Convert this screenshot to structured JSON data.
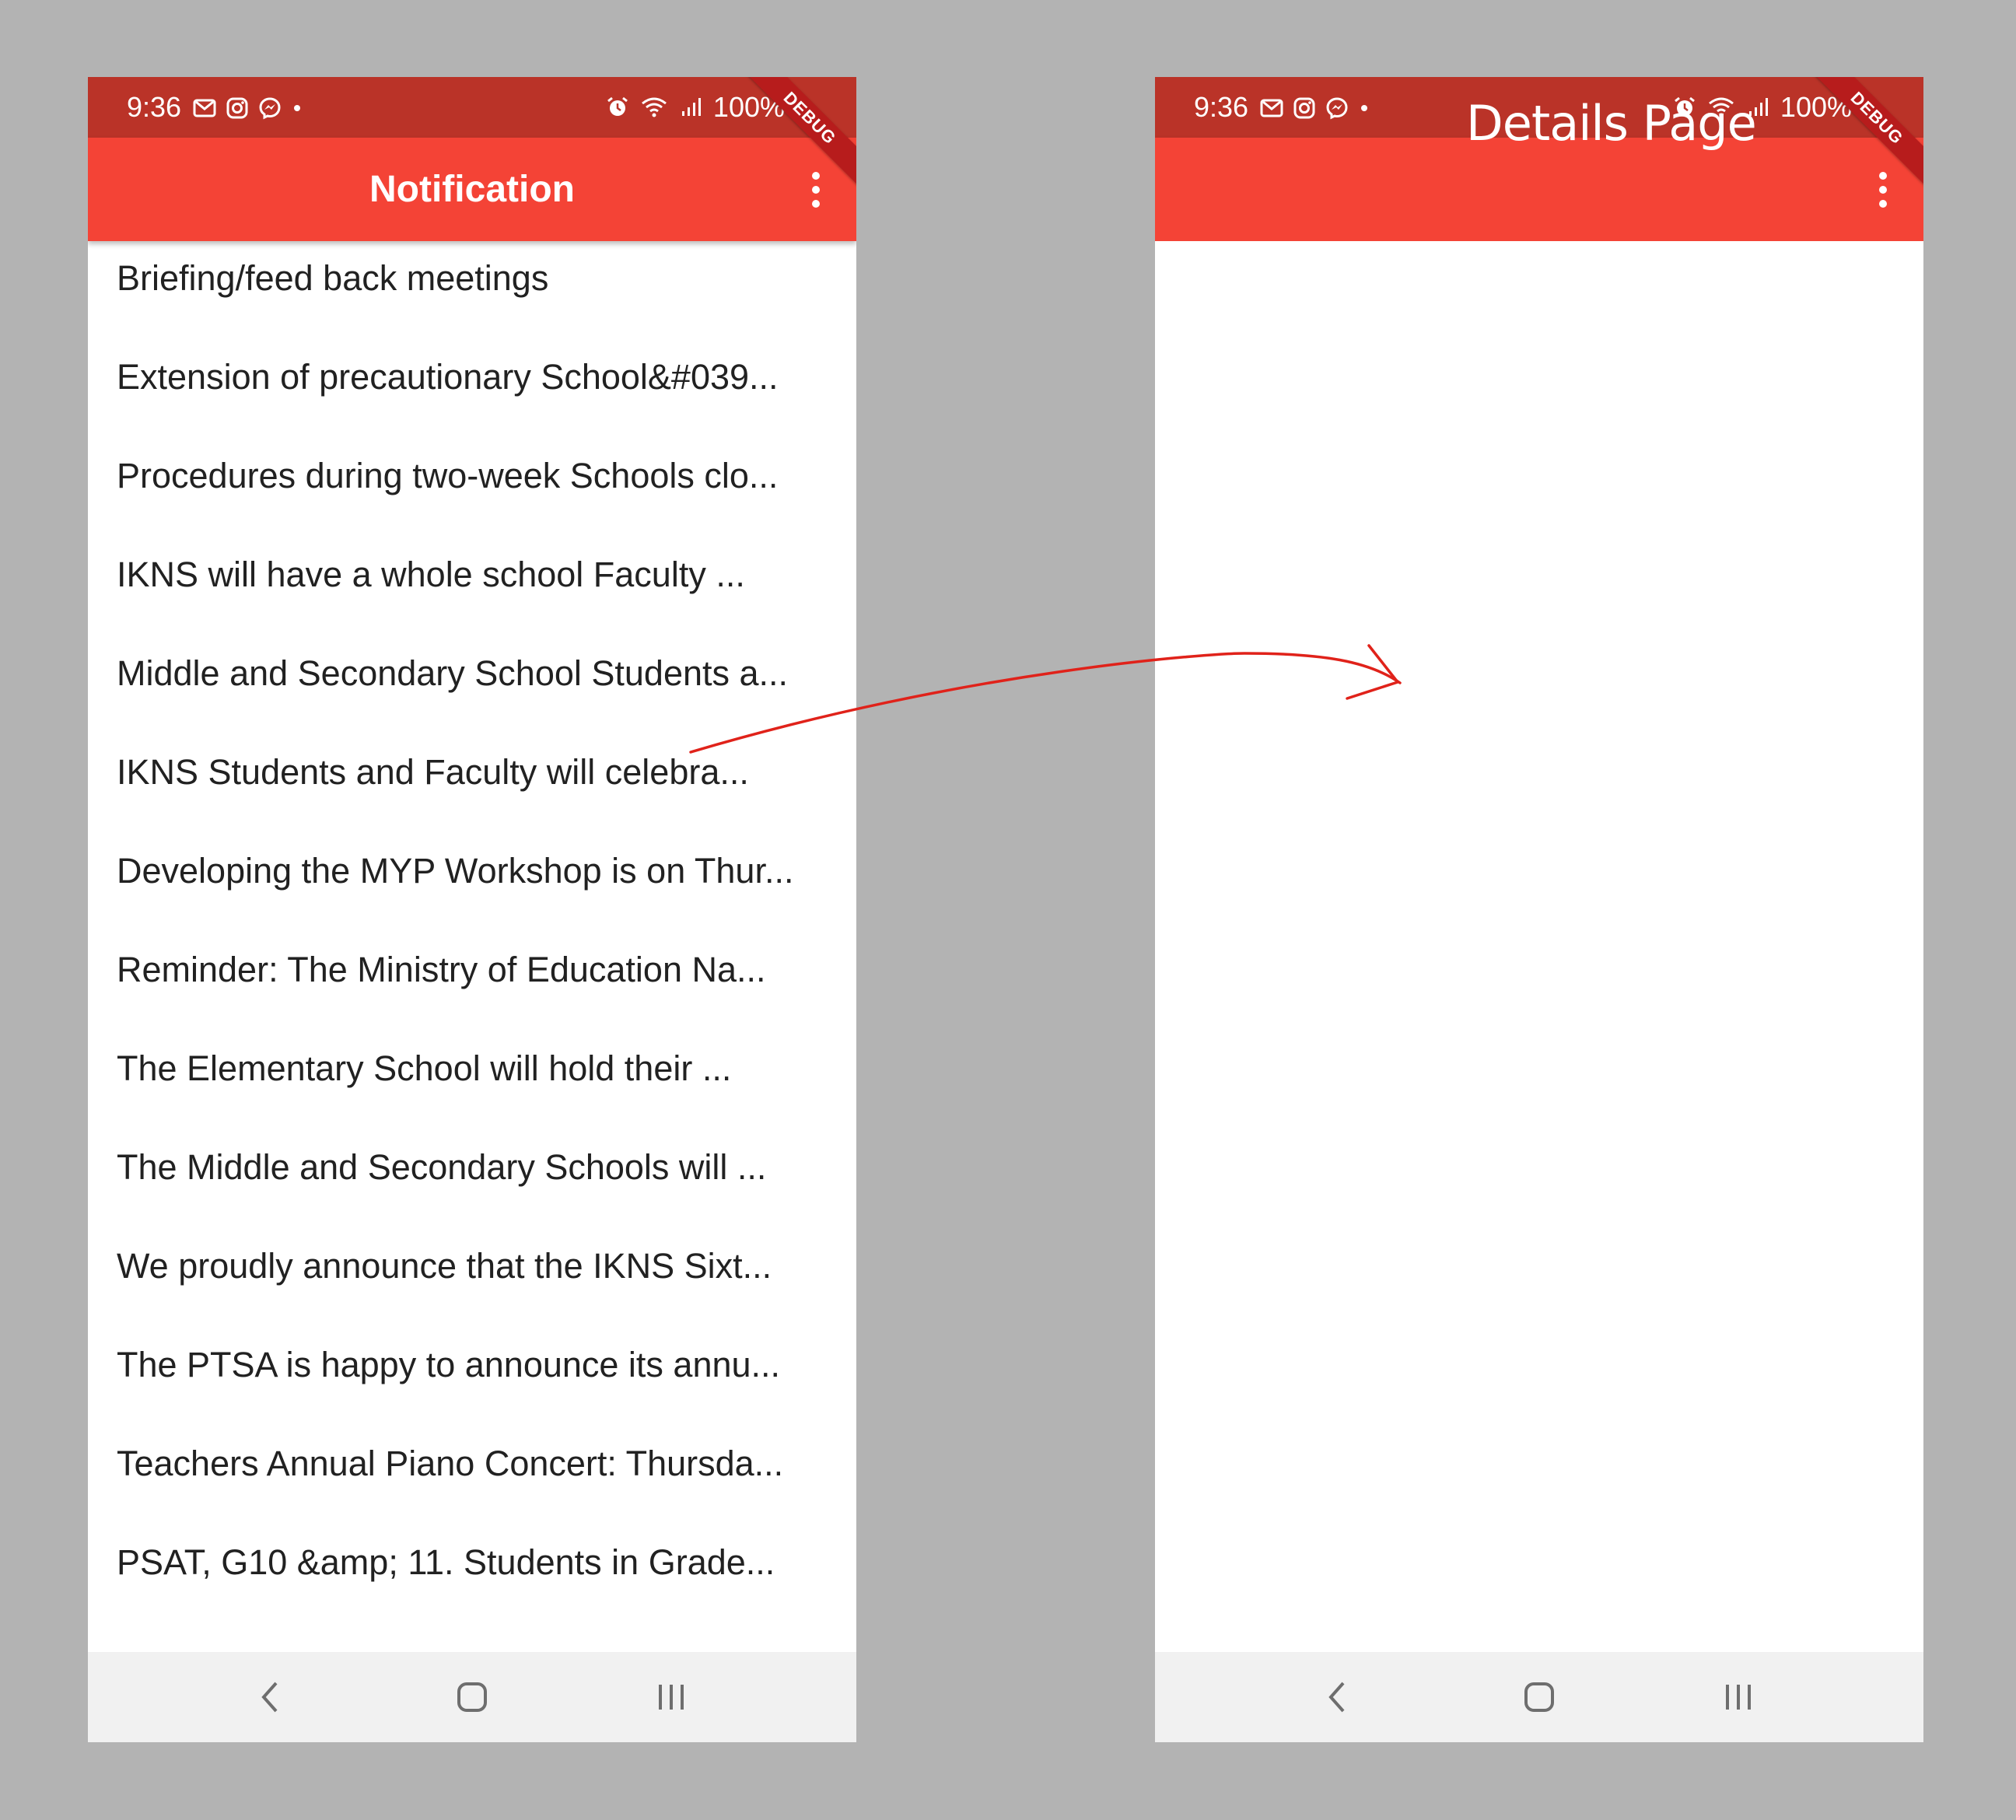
{
  "status_bar": {
    "time": "9:36",
    "battery": "100%",
    "color": "#ba3328",
    "left_icons": [
      "gmail-icon",
      "instagram-icon",
      "messenger-icon",
      "dot-icon"
    ],
    "right_icons": [
      "alarm-icon",
      "wifi-icon",
      "signal-icon",
      "battery-icon"
    ]
  },
  "debug_banner": "DEBUG",
  "notification_screen": {
    "app_bar_title": "Notification",
    "app_bar_color": "#f44336",
    "menu_icon": "more-vert-icon",
    "items": [
      "Briefing/feed back meetings",
      "Extension of precautionary School&#039...",
      "Procedures during two-week Schools clo...",
      "IKNS will have a whole school Faculty ...",
      "Middle and Secondary School Students a...",
      "IKNS Students and Faculty will celebra...",
      "Developing the MYP Workshop is on Thur...",
      "Reminder: The Ministry of Education Na...",
      "The Elementary School will hold their ...",
      "The Middle and Secondary Schools will ...",
      "We proudly announce that the IKNS Sixt...",
      "The PTSA is happy to announce its annu...",
      "Teachers Annual Piano Concert: Thursda...",
      "PSAT, G10 &amp; 11.  Students in Grade..."
    ]
  },
  "details_screen": {
    "title": "Details Page",
    "menu_icon": "more-vert-icon"
  },
  "nav_bar": {
    "buttons": [
      "back-icon",
      "home-icon",
      "recents-icon"
    ]
  },
  "annotation": {
    "arrow_color": "#e0221a"
  }
}
